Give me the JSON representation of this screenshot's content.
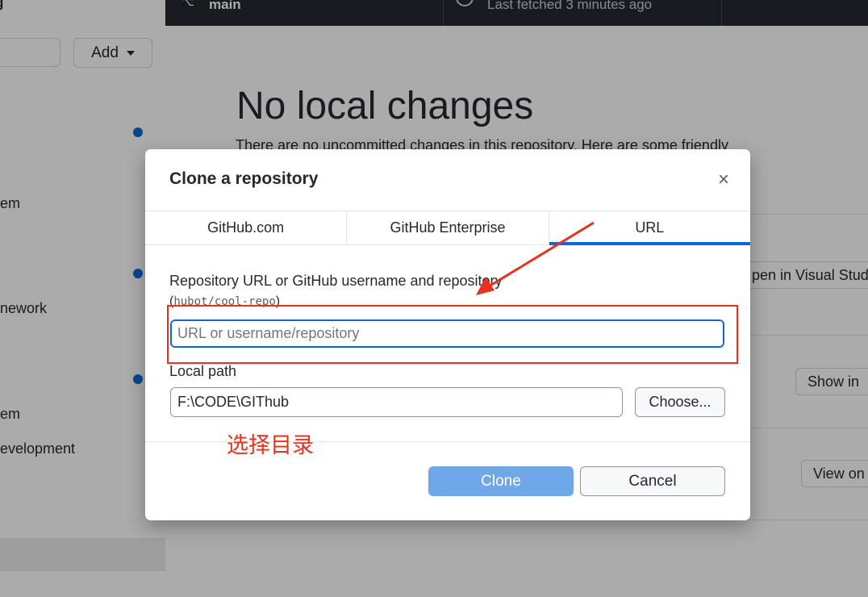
{
  "sidebar": {
    "title": "g",
    "add_label": "Add",
    "items": [
      "em",
      "nework",
      "em",
      "evelopment"
    ]
  },
  "toolbar": {
    "branch": "main",
    "fetch_status": "Last fetched 3 minutes ago"
  },
  "main": {
    "title": "No local changes",
    "description": "There are no uncommitted changes in this repository. Here are some friendly",
    "cards": {
      "open_editor": "pen in Visual Stud",
      "show_in": "Show in",
      "view_on": "View on"
    }
  },
  "dialog": {
    "title": "Clone a repository",
    "close_glyph": "×",
    "tabs": [
      {
        "label": "GitHub.com",
        "selected": false
      },
      {
        "label": "GitHub Enterprise",
        "selected": false
      },
      {
        "label": "URL",
        "selected": true
      }
    ],
    "url_field": {
      "label": "Repository URL or GitHub username and repository",
      "hint_open": "(",
      "hint_code": "hubot/cool-repo",
      "hint_close": ")",
      "placeholder": "URL or username/repository",
      "value": ""
    },
    "path_field": {
      "label": "Local path",
      "value": "F:\\CODE\\GIThub"
    },
    "choose_label": "Choose...",
    "clone_label": "Clone",
    "cancel_label": "Cancel"
  },
  "annotation": {
    "text": "选择目录",
    "color": "#e8321f"
  },
  "colors": {
    "accent": "#0969da",
    "clone_disabled": "#6ea8e8",
    "topbar": "#24292f"
  }
}
